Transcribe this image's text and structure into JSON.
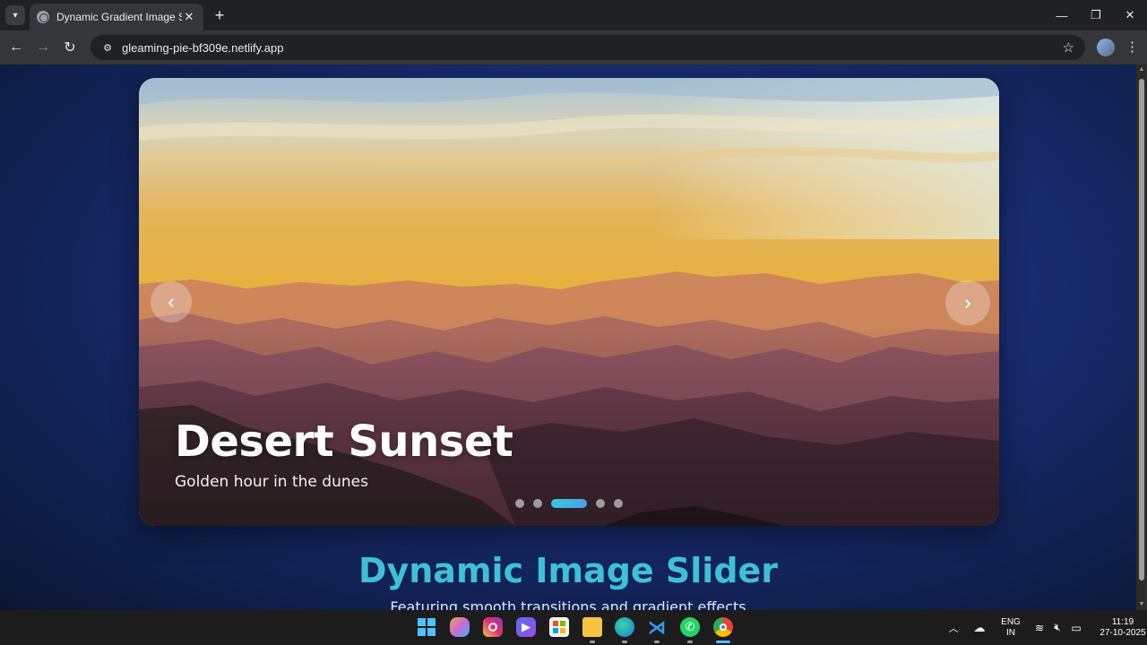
{
  "browser": {
    "tab_title": "Dynamic Gradient Image Slider",
    "url": "gleaming-pie-bf309e.netlify.app"
  },
  "slider": {
    "current_title": "Desert Sunset",
    "current_caption": "Golden hour in the dunes",
    "slide_count": 5,
    "active_index": 2,
    "prev_symbol": "‹",
    "next_symbol": "›"
  },
  "page": {
    "heading": "Dynamic Image Slider",
    "subheading": "Featuring smooth transitions and gradient effects"
  },
  "taskbar": {
    "apps": [
      "windows-start",
      "copilot",
      "instagram",
      "clipchamp",
      "microsoft-store",
      "file-explorer",
      "edge",
      "vscode",
      "whatsapp",
      "chrome"
    ],
    "language_line1": "ENG",
    "language_line2": "IN",
    "time": "11:19",
    "date": "27-10-2025"
  },
  "colors": {
    "accent": "#3ec1d8",
    "active_dot_start": "#3ec6e0",
    "active_dot_end": "#4aa0e8",
    "page_bg": "#1b2f7a"
  }
}
